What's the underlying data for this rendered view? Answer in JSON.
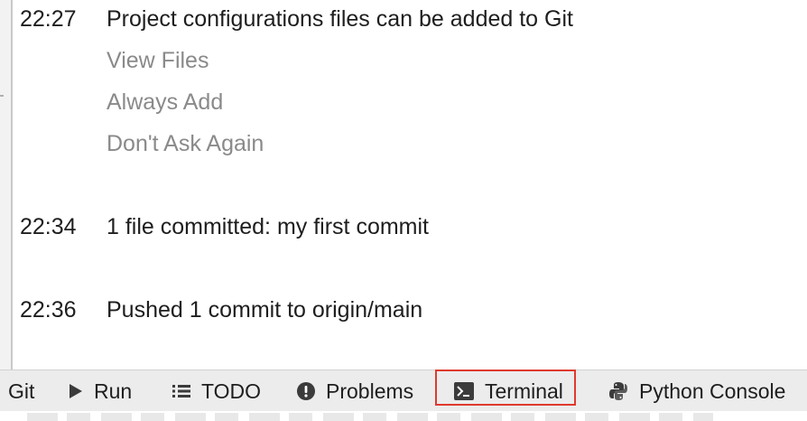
{
  "notifications": [
    {
      "time": "22:27",
      "message": "Project configurations files can be added to Git",
      "actions": [
        "View Files",
        "Always Add",
        "Don't Ask Again"
      ]
    },
    {
      "time": "22:34",
      "message": "1 file committed: my  first commit"
    },
    {
      "time": "22:36",
      "message": "Pushed 1 commit to origin/main"
    }
  ],
  "toolbar": {
    "git": "Git",
    "run": "Run",
    "todo": "TODO",
    "problems": "Problems",
    "terminal": "Terminal",
    "python_console": "Python Console",
    "highlighted_tab": "Terminal"
  },
  "icons": {
    "run": "play-icon",
    "todo": "list-icon",
    "problems": "exclamation-circle-icon",
    "terminal": "terminal-prompt-icon",
    "python_console": "python-logo-icon"
  },
  "colors": {
    "highlight": "#e03a2e",
    "action_text": "#8a8a8a",
    "toolbar_bg": "#ececec"
  }
}
